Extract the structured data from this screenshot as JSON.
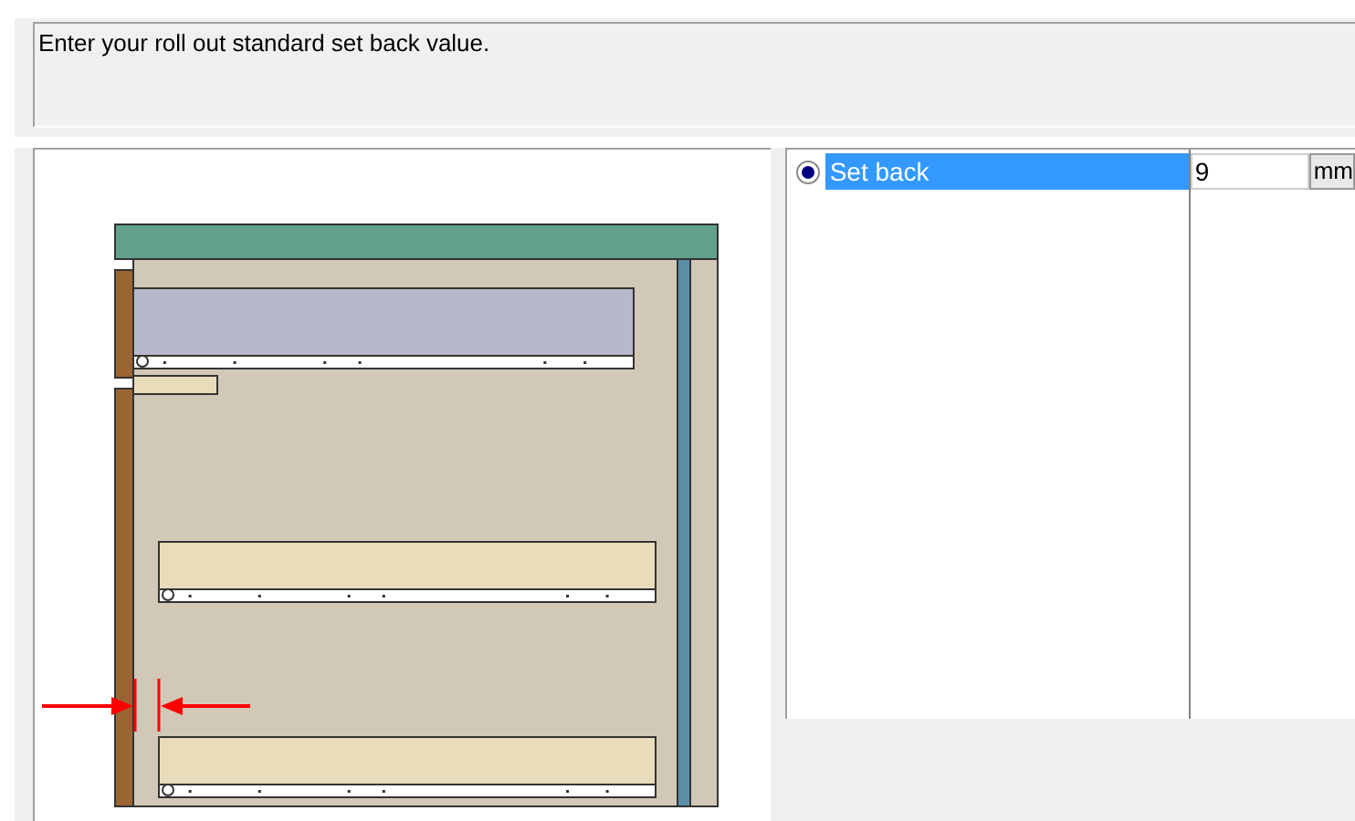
{
  "prompt": "Enter your roll out standard set back value.",
  "options": [
    {
      "label": "Set back",
      "selected": true
    }
  ],
  "value": "9",
  "unit": "mm"
}
